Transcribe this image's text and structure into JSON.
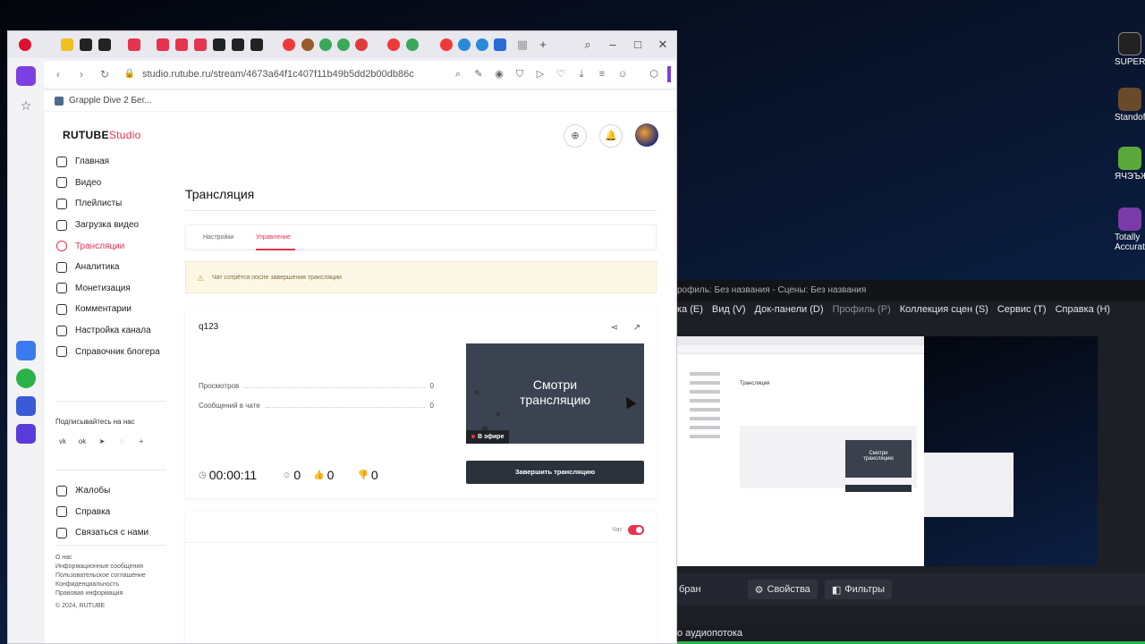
{
  "browser": {
    "url": "studio.rutube.ru/stream/4673a64f1c407f11b49b5dd2b00db86c",
    "bookmark": "Grapple Dive 2 Бег..."
  },
  "brand": {
    "logo_main": "RUTUBE",
    "logo_studio": "Studio"
  },
  "nav": {
    "items": [
      "Главная",
      "Видео",
      "Плейлисты",
      "Загрузка видео",
      "Трансляции",
      "Аналитика",
      "Монетизация",
      "Комментарии",
      "Настройка канала",
      "Справочник блогера"
    ],
    "active_index": 4,
    "subscribe_heading": "Подписывайтесь на нас",
    "secondary": [
      "Жалобы",
      "Справка",
      "Связаться с нами"
    ],
    "footer_links": [
      "О нас",
      "Информационные сообщения",
      "Пользовательское соглашение",
      "Конфиденциальность",
      "Правовая информация"
    ],
    "copyright": "© 2024, RUTUBE"
  },
  "main": {
    "title": "Трансляция",
    "tabs": [
      "Настройки",
      "Управление"
    ],
    "active_tab": 1,
    "notice": "Чат сотрётся после завершения трансляции",
    "stream": {
      "name": "q123",
      "views_label": "Просмотров",
      "views_value": "0",
      "chat_label": "Сообщений в чате",
      "chat_value": "0",
      "timer": "00:00:11",
      "viewers": "0",
      "likes": "0",
      "dislikes": "0",
      "preview_text_line1": "Смотри",
      "preview_text_line2": "трансляцию",
      "live_badge": "В эфире",
      "end_button": "Завершить трансляцию"
    },
    "chat_toggle_label": "Чат",
    "chat_enabled": true
  },
  "obs": {
    "title": "рофиль: Без названия - Сцены: Без названия",
    "menu": [
      "ка (E)",
      "Вид (V)",
      "Док-панели (D)",
      "Профиль (P)",
      "Коллекция сцен (S)",
      "Сервис (T)",
      "Справка (H)"
    ],
    "source_label": "бран",
    "properties_button": "Свойства",
    "filters_button": "Фильтры",
    "audio_label": "о аудиопотока"
  },
  "desktop_icons": [
    "SUPERH",
    "Standof",
    "ЯЧЭЪЖ",
    "Totally Accurat"
  ],
  "colors": {
    "accent": "#e6334f",
    "dark_button": "#2c323c",
    "opera_red": "#e0102f"
  }
}
